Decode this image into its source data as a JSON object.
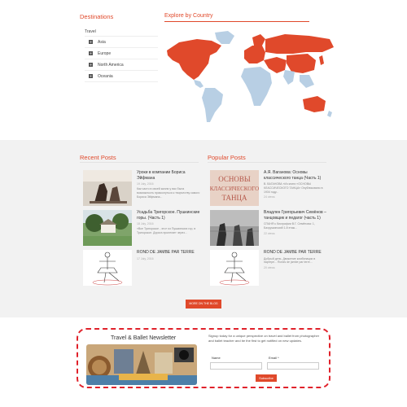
{
  "destinations": {
    "title": "Destinations",
    "root": "Travel",
    "items": [
      "Asia",
      "Europe",
      "North America",
      "Oceania"
    ]
  },
  "explore": {
    "title": "Explore by Country"
  },
  "recent": {
    "title": "Recent Posts",
    "posts": [
      {
        "title": "Уроки в компании Бориса Эйфмана",
        "date": "19 July, 2016",
        "excerpt": "Как часто в своей жизни у вас была возможность прикоснуться к творчеству самого Бориса Эйфмана..."
      },
      {
        "title": "Усадьба Тригорское. Пушкинские горы. (Часть 1)",
        "date": "18 July, 2016",
        "excerpt": "«Все Тригорское - это» из Пушкинских гор, в Тригорское. Дорога пролегает через..."
      },
      {
        "title": "ROND DE JAMBE PAR TERRE",
        "date": "17 July, 2016",
        "excerpt": ""
      }
    ]
  },
  "popular": {
    "title": "Popular Posts",
    "posts": [
      {
        "title": "А.Я. Ваганова: Основы классического танца (Часть 1)",
        "date": "24 views",
        "excerpt": "В. ВАГАНОВА «Из книги «ОСНОВЫ КЛАССИЧЕСКОГО ТАНЦА» Опубликовано в 1934 году..."
      },
      {
        "title": "Владлен Григорьевич Семёнов – танцовщик и педагог (часть 1)",
        "date": "22 views",
        "excerpt": "СПАНЯ к биографии В.Г. Семёнова: 1, Бахрушинский 1-й этаж..."
      },
      {
        "title": "ROND DE JAMBE PAR TERRE",
        "date": "20 views",
        "excerpt": "Добрый день. Движение комбинации в партере... Ronds de jambe par terre..."
      }
    ]
  },
  "blog_button": "MORE ON THE BLOG",
  "newsletter": {
    "title": "Travel & Ballet Newsletter",
    "description": "Signup today for a unique perspective on travel and ballet from photographer and ballet teacher and be the first to get notified on new updates.",
    "name_label": "Name",
    "email_label": "Email *",
    "submit": "Subscribe"
  },
  "colors": {
    "accent": "#e0492b",
    "map_highlight": "#e0492b",
    "map_base": "#b8cfe4",
    "dashed_border": "#e0222b"
  }
}
